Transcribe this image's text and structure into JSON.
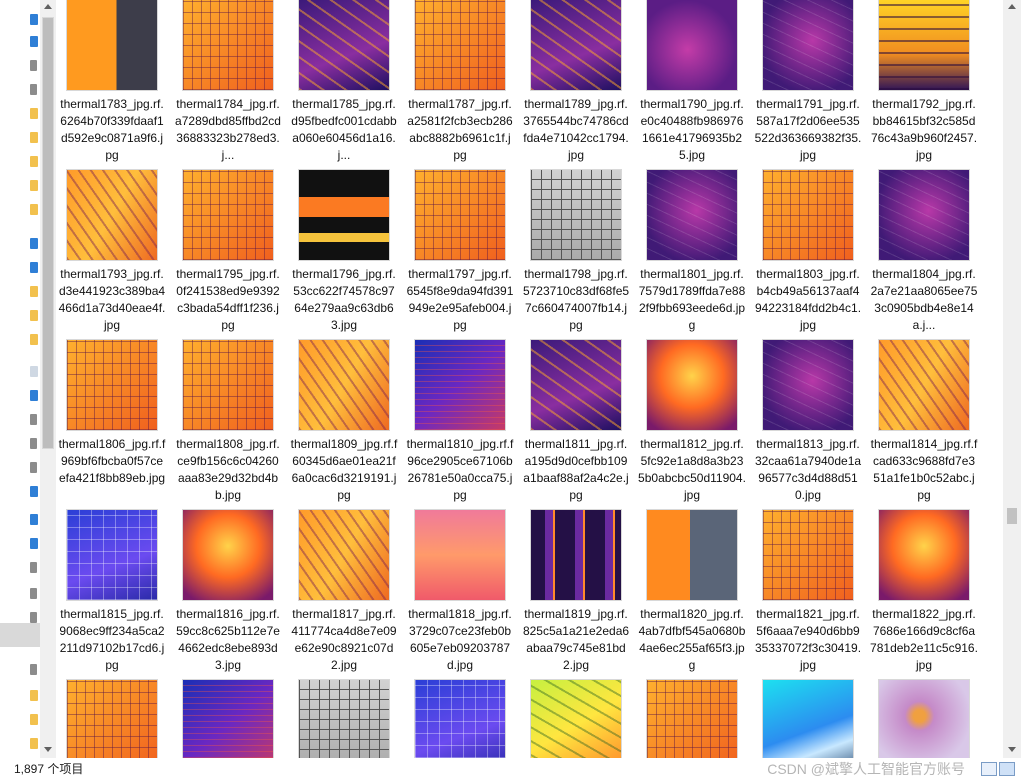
{
  "status": {
    "item_count": "1,897 个项目",
    "watermark": "CSDN @斌擎人工智能官方账号"
  },
  "files": [
    {
      "name": "thermal1783_jpg.rf.6264b70f339fdaaf1d592e9c0871a9f6.jpg",
      "style": "orange-panel"
    },
    {
      "name": "thermal1784_jpg.rf.a7289dbd85ffbd2cd36883323b278ed3.j...",
      "style": "orange-grid"
    },
    {
      "name": "thermal1785_jpg.rf.d95fbedfc001cdabba060e60456d1a16.j...",
      "style": "purple-diag"
    },
    {
      "name": "thermal1787_jpg.rf.a2581f2fcb3ecb286abc8882b6961c1f.jpg",
      "style": "orange-grid"
    },
    {
      "name": "thermal1789_jpg.rf.3765544bc74786cdfda4e71042cc1794.jpg",
      "style": "purple-diag"
    },
    {
      "name": "thermal1790_jpg.rf.e0c40488fb9869761661e41796935b25.jpg",
      "style": "magenta"
    },
    {
      "name": "thermal1791_jpg.rf.587a17f2d06ee535522d363669382f35.jpg",
      "style": "purple-dark"
    },
    {
      "name": "thermal1792_jpg.rf.bb84615bf32c585d76c43a9b960f2457.jpg",
      "style": "yellow-dark"
    },
    {
      "name": "thermal1793_jpg.rf.d3e441923c389ba4466d1a73d40eae4f.jpg",
      "style": "orange-diag"
    },
    {
      "name": "thermal1795_jpg.rf.0f241538ed9e9392c3bada54dff1f236.jpg",
      "style": "orange-grid"
    },
    {
      "name": "thermal1796_jpg.rf.53cc622f74578c9764e279aa9c63db63.jpg",
      "style": "black-strip"
    },
    {
      "name": "thermal1797_jpg.rf.6545f8e9da94fd391949e2e95afeb004.jpg",
      "style": "orange-grid"
    },
    {
      "name": "thermal1798_jpg.rf.5723710c83df68fe57c660474007fb14.jpg",
      "style": "gray-grid"
    },
    {
      "name": "thermal1801_jpg.rf.7579d1789ffda7e882f9fbb693eede6d.jpg",
      "style": "purple-dark"
    },
    {
      "name": "thermal1803_jpg.rf.b4cb49a56137aaf494223184fdd2b4c1.jpg",
      "style": "orange-grid"
    },
    {
      "name": "thermal1804_jpg.rf.2a7e21aa8065ee753c0905bdb4e8e14a.j...",
      "style": "purple-dark"
    },
    {
      "name": "thermal1806_jpg.rf.f969bf6fbcba0f57ceefa421f8bb89eb.jpg",
      "style": "orange-grid"
    },
    {
      "name": "thermal1808_jpg.rf.ce9fb156c6c04260aaa83e29d32bd4bb.jpg",
      "style": "orange-grid"
    },
    {
      "name": "thermal1809_jpg.rf.f60345d6ae01ea21f6a0cac6d3219191.jpg",
      "style": "orange-diag"
    },
    {
      "name": "thermal1810_jpg.rf.f96ce2905ce67106b26781e50a0cca75.jpg",
      "style": "blue-noise"
    },
    {
      "name": "thermal1811_jpg.rf.a195d9d0cefbb109a1baaf88af2a4c2e.jpg",
      "style": "purple-diag"
    },
    {
      "name": "thermal1812_jpg.rf.5fc92e1a8d8a3b235b0abcbc50d11904.jpg",
      "style": "red-orange"
    },
    {
      "name": "thermal1813_jpg.rf.32caa61a7940de1a96577c3d4d88d510.jpg",
      "style": "purple-dark"
    },
    {
      "name": "thermal1814_jpg.rf.fcad633c9688fd7e351a1fe1b0c52abc.jpg",
      "style": "orange-diag"
    },
    {
      "name": "thermal1815_jpg.rf.9068ec9ff234a5ca2211d97102b17cd6.jpg",
      "style": "blue-grid"
    },
    {
      "name": "thermal1816_jpg.rf.59cc8c625b112e7e4662edc8ebe893d3.jpg",
      "style": "red-orange"
    },
    {
      "name": "thermal1817_jpg.rf.411774ca4d8e7e09e62e90c8921c07d2.jpg",
      "style": "orange-diag"
    },
    {
      "name": "thermal1818_jpg.rf.3729c07ce23feb0b605e7eb09203787d.jpg",
      "style": "pink-noise"
    },
    {
      "name": "thermal1819_jpg.rf.825c5a1a21e2eda6abaa79c745e81bd2.jpg",
      "style": "purple-strip"
    },
    {
      "name": "thermal1820_jpg.rf.4ab7dfbf545a0680b4ae6ec255af65f3.jpg",
      "style": "orange-gray"
    },
    {
      "name": "thermal1821_jpg.rf.5f6aaa7e940d6bb935337072f3c30419.jpg",
      "style": "orange-grid"
    },
    {
      "name": "thermal1822_jpg.rf.7686e166d9c8cf6a781deb2e11c5c916.jpg",
      "style": "red-orange"
    },
    {
      "name": "",
      "style": "orange-grid"
    },
    {
      "name": "",
      "style": "blue-noise"
    },
    {
      "name": "",
      "style": "gray-grid"
    },
    {
      "name": "",
      "style": "blue-grid"
    },
    {
      "name": "",
      "style": "green"
    },
    {
      "name": "",
      "style": "orange-grid"
    },
    {
      "name": "",
      "style": "cyan"
    },
    {
      "name": "",
      "style": "lavender"
    }
  ]
}
